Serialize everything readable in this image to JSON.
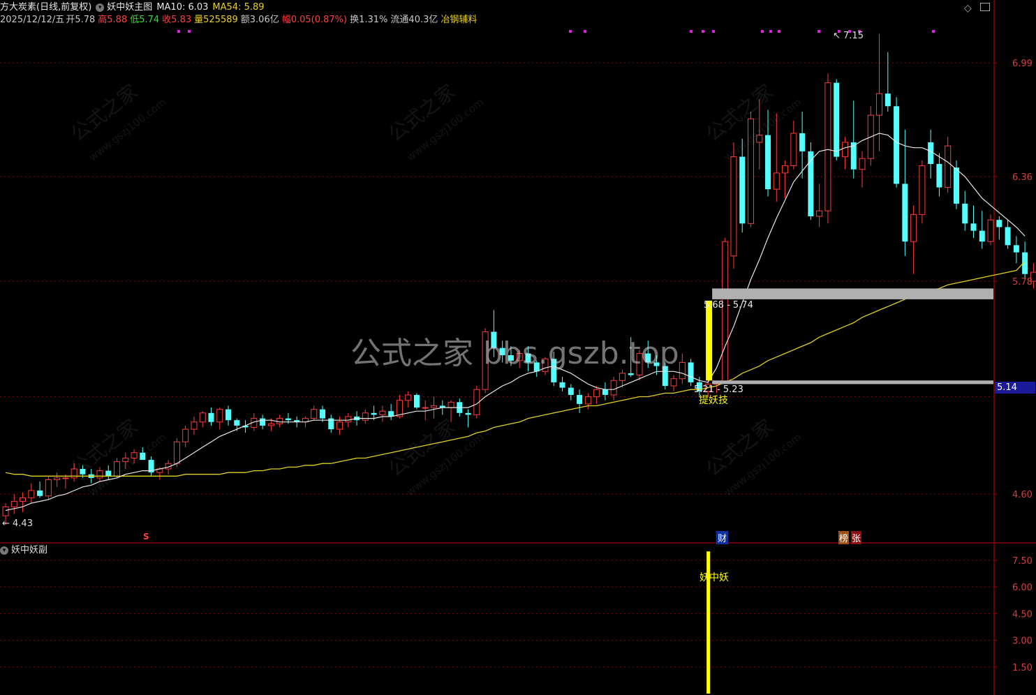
{
  "header": {
    "stock_name": "方大炭素",
    "period": "(日线,前复权)",
    "indicator_name": "妖中妖主图",
    "ma10_label": "MA10: 6.03",
    "ma54_label": "MA54: 5.89",
    "date": "2025/12/12/五",
    "open": "开5.78",
    "high": "高5.88",
    "low": "低5.74",
    "close": "收5.83",
    "volume": "量525589",
    "amount": "额3.06亿",
    "change": "幅0.05(0.87%)",
    "turnover": "换1.31%",
    "float_cap": "流通40.3亿",
    "sector": "冶钢辅料"
  },
  "sub_panel": {
    "title": "妖中妖副",
    "signal_label": "妖中妖"
  },
  "watermark": {
    "center": "公式之家 bbs.gszb.top",
    "tile_cn": "公式之家",
    "tile_url": "www.gszj100.com"
  },
  "colors": {
    "up": "#ff3b3b",
    "down": "#54ffff",
    "ma10": "#e8e8e8",
    "ma54": "#e0d020",
    "grid": "#8b0000",
    "signal": "#ffff00",
    "zone": "#b0b0b0",
    "price_tag_bg": "#1a1a9a"
  },
  "markers": {
    "high_label": "7.15",
    "low_label": "4.43",
    "zone_top_label": "5.68 - 5.74",
    "zone_bottom_label": "5.21 - 5.23",
    "signal_text": "提妖技",
    "current_price_tag": "5.14",
    "event_cai": "财",
    "event_bang": "榜",
    "event_zhang": "张",
    "event_s": "S"
  },
  "chart_data": {
    "type": "candlestick",
    "main_ylim": [
      4.33,
      7.3
    ],
    "main_yticks": [
      "6.99",
      "6.36",
      "5.78",
      "4.60"
    ],
    "sub_yticks": [
      "7.50",
      "6.00",
      "4.50",
      "3.00",
      "1.50"
    ],
    "sub_ylim": [
      0,
      8.4
    ],
    "zone_upper": [
      5.68,
      5.74
    ],
    "zone_lower": [
      5.21,
      5.23
    ],
    "signal_index": 82,
    "candles": [
      {
        "o": 4.48,
        "h": 4.55,
        "l": 4.43,
        "c": 4.53
      },
      {
        "o": 4.53,
        "h": 4.6,
        "l": 4.49,
        "c": 4.56
      },
      {
        "o": 4.56,
        "h": 4.61,
        "l": 4.5,
        "c": 4.58
      },
      {
        "o": 4.58,
        "h": 4.66,
        "l": 4.55,
        "c": 4.62
      },
      {
        "o": 4.62,
        "h": 4.67,
        "l": 4.58,
        "c": 4.59
      },
      {
        "o": 4.59,
        "h": 4.7,
        "l": 4.57,
        "c": 4.68
      },
      {
        "o": 4.68,
        "h": 4.72,
        "l": 4.64,
        "c": 4.69
      },
      {
        "o": 4.69,
        "h": 4.71,
        "l": 4.63,
        "c": 4.69
      },
      {
        "o": 4.69,
        "h": 4.77,
        "l": 4.67,
        "c": 4.74
      },
      {
        "o": 4.74,
        "h": 4.76,
        "l": 4.69,
        "c": 4.71
      },
      {
        "o": 4.71,
        "h": 4.74,
        "l": 4.66,
        "c": 4.69
      },
      {
        "o": 4.69,
        "h": 4.75,
        "l": 4.67,
        "c": 4.73
      },
      {
        "o": 4.73,
        "h": 4.76,
        "l": 4.68,
        "c": 4.7
      },
      {
        "o": 4.7,
        "h": 4.8,
        "l": 4.69,
        "c": 4.78
      },
      {
        "o": 4.78,
        "h": 4.83,
        "l": 4.74,
        "c": 4.8
      },
      {
        "o": 4.8,
        "h": 4.85,
        "l": 4.77,
        "c": 4.83
      },
      {
        "o": 4.83,
        "h": 4.86,
        "l": 4.79,
        "c": 4.79
      },
      {
        "o": 4.79,
        "h": 4.81,
        "l": 4.7,
        "c": 4.72
      },
      {
        "o": 4.72,
        "h": 4.75,
        "l": 4.68,
        "c": 4.74
      },
      {
        "o": 4.74,
        "h": 4.79,
        "l": 4.71,
        "c": 4.77
      },
      {
        "o": 4.77,
        "h": 4.91,
        "l": 4.75,
        "c": 4.89
      },
      {
        "o": 4.89,
        "h": 4.98,
        "l": 4.86,
        "c": 4.96
      },
      {
        "o": 4.96,
        "h": 5.03,
        "l": 4.93,
        "c": 5.0
      },
      {
        "o": 5.0,
        "h": 5.06,
        "l": 4.97,
        "c": 5.05
      },
      {
        "o": 5.05,
        "h": 5.08,
        "l": 4.98,
        "c": 5.0
      },
      {
        "o": 5.0,
        "h": 5.08,
        "l": 4.96,
        "c": 5.07
      },
      {
        "o": 5.07,
        "h": 5.09,
        "l": 4.98,
        "c": 5.01
      },
      {
        "o": 5.01,
        "h": 5.02,
        "l": 4.95,
        "c": 4.98
      },
      {
        "o": 4.98,
        "h": 5.01,
        "l": 4.94,
        "c": 4.97
      },
      {
        "o": 4.97,
        "h": 5.05,
        "l": 4.95,
        "c": 5.02
      },
      {
        "o": 5.02,
        "h": 5.04,
        "l": 4.96,
        "c": 4.98
      },
      {
        "o": 4.98,
        "h": 5.02,
        "l": 4.95,
        "c": 4.99
      },
      {
        "o": 4.99,
        "h": 5.04,
        "l": 4.97,
        "c": 5.02
      },
      {
        "o": 5.02,
        "h": 5.05,
        "l": 4.99,
        "c": 5.01
      },
      {
        "o": 5.01,
        "h": 5.03,
        "l": 4.97,
        "c": 5.0
      },
      {
        "o": 5.0,
        "h": 5.03,
        "l": 4.97,
        "c": 5.02
      },
      {
        "o": 5.02,
        "h": 5.09,
        "l": 5.01,
        "c": 5.07
      },
      {
        "o": 5.07,
        "h": 5.09,
        "l": 5.0,
        "c": 5.02
      },
      {
        "o": 5.02,
        "h": 5.04,
        "l": 4.94,
        "c": 4.96
      },
      {
        "o": 4.96,
        "h": 5.03,
        "l": 4.93,
        "c": 5.0
      },
      {
        "o": 5.0,
        "h": 5.05,
        "l": 4.97,
        "c": 5.03
      },
      {
        "o": 5.03,
        "h": 5.06,
        "l": 4.98,
        "c": 5.01
      },
      {
        "o": 5.01,
        "h": 5.07,
        "l": 4.99,
        "c": 5.05
      },
      {
        "o": 5.05,
        "h": 5.09,
        "l": 5.01,
        "c": 5.04
      },
      {
        "o": 5.04,
        "h": 5.09,
        "l": 5.0,
        "c": 5.06
      },
      {
        "o": 5.06,
        "h": 5.1,
        "l": 5.01,
        "c": 5.03
      },
      {
        "o": 5.03,
        "h": 5.15,
        "l": 5.02,
        "c": 5.12
      },
      {
        "o": 5.12,
        "h": 5.17,
        "l": 5.08,
        "c": 5.15
      },
      {
        "o": 5.15,
        "h": 5.16,
        "l": 5.07,
        "c": 5.08
      },
      {
        "o": 5.08,
        "h": 5.12,
        "l": 5.01,
        "c": 5.08
      },
      {
        "o": 5.08,
        "h": 5.14,
        "l": 5.02,
        "c": 5.09
      },
      {
        "o": 5.09,
        "h": 5.12,
        "l": 5.04,
        "c": 5.08
      },
      {
        "o": 5.08,
        "h": 5.12,
        "l": 5.0,
        "c": 5.11
      },
      {
        "o": 5.11,
        "h": 5.13,
        "l": 5.03,
        "c": 5.05
      },
      {
        "o": 5.05,
        "h": 5.07,
        "l": 4.97,
        "c": 5.04
      },
      {
        "o": 5.04,
        "h": 5.2,
        "l": 5.02,
        "c": 5.18
      },
      {
        "o": 5.18,
        "h": 5.52,
        "l": 5.16,
        "c": 5.5
      },
      {
        "o": 5.5,
        "h": 5.62,
        "l": 5.36,
        "c": 5.41
      },
      {
        "o": 5.41,
        "h": 5.45,
        "l": 5.33,
        "c": 5.37
      },
      {
        "o": 5.37,
        "h": 5.42,
        "l": 5.31,
        "c": 5.34
      },
      {
        "o": 5.34,
        "h": 5.4,
        "l": 5.3,
        "c": 5.38
      },
      {
        "o": 5.38,
        "h": 5.42,
        "l": 5.28,
        "c": 5.33
      },
      {
        "o": 5.33,
        "h": 5.34,
        "l": 5.25,
        "c": 5.28
      },
      {
        "o": 5.28,
        "h": 5.36,
        "l": 5.26,
        "c": 5.35
      },
      {
        "o": 5.35,
        "h": 5.39,
        "l": 5.2,
        "c": 5.22
      },
      {
        "o": 5.22,
        "h": 5.25,
        "l": 5.17,
        "c": 5.19
      },
      {
        "o": 5.19,
        "h": 5.21,
        "l": 5.12,
        "c": 5.15
      },
      {
        "o": 5.15,
        "h": 5.18,
        "l": 5.05,
        "c": 5.1
      },
      {
        "o": 5.1,
        "h": 5.16,
        "l": 5.07,
        "c": 5.14
      },
      {
        "o": 5.14,
        "h": 5.2,
        "l": 5.1,
        "c": 5.18
      },
      {
        "o": 5.18,
        "h": 5.22,
        "l": 5.12,
        "c": 5.15
      },
      {
        "o": 5.15,
        "h": 5.25,
        "l": 5.12,
        "c": 5.23
      },
      {
        "o": 5.23,
        "h": 5.29,
        "l": 5.19,
        "c": 5.27
      },
      {
        "o": 5.27,
        "h": 5.47,
        "l": 5.25,
        "c": 5.26
      },
      {
        "o": 5.26,
        "h": 5.4,
        "l": 5.23,
        "c": 5.38
      },
      {
        "o": 5.38,
        "h": 5.45,
        "l": 5.3,
        "c": 5.33
      },
      {
        "o": 5.33,
        "h": 5.37,
        "l": 5.26,
        "c": 5.31
      },
      {
        "o": 5.31,
        "h": 5.33,
        "l": 5.18,
        "c": 5.2
      },
      {
        "o": 5.2,
        "h": 5.26,
        "l": 5.17,
        "c": 5.24
      },
      {
        "o": 5.24,
        "h": 5.38,
        "l": 5.21,
        "c": 5.33
      },
      {
        "o": 5.33,
        "h": 5.35,
        "l": 5.2,
        "c": 5.22
      },
      {
        "o": 5.22,
        "h": 5.25,
        "l": 5.14,
        "c": 5.17
      },
      {
        "o": 5.17,
        "h": 5.26,
        "l": 5.14,
        "c": 5.21
      },
      {
        "o": 5.21,
        "h": 5.23,
        "l": 5.16,
        "c": 5.22
      },
      {
        "o": 5.22,
        "h": 6.02,
        "l": 5.82,
        "c": 6.0
      },
      {
        "o": 5.92,
        "h": 6.55,
        "l": 5.85,
        "c": 6.47
      },
      {
        "o": 6.47,
        "h": 6.57,
        "l": 6.05,
        "c": 6.1
      },
      {
        "o": 6.1,
        "h": 6.72,
        "l": 6.08,
        "c": 6.68
      },
      {
        "o": 6.55,
        "h": 6.79,
        "l": 6.4,
        "c": 6.59
      },
      {
        "o": 6.59,
        "h": 6.73,
        "l": 6.25,
        "c": 6.29
      },
      {
        "o": 6.29,
        "h": 6.71,
        "l": 6.22,
        "c": 6.38
      },
      {
        "o": 6.38,
        "h": 6.45,
        "l": 6.24,
        "c": 6.42
      },
      {
        "o": 6.42,
        "h": 6.67,
        "l": 6.4,
        "c": 6.6
      },
      {
        "o": 6.6,
        "h": 6.72,
        "l": 6.35,
        "c": 6.5
      },
      {
        "o": 6.5,
        "h": 6.55,
        "l": 6.12,
        "c": 6.14
      },
      {
        "o": 6.14,
        "h": 6.32,
        "l": 6.08,
        "c": 6.17
      },
      {
        "o": 6.17,
        "h": 6.93,
        "l": 6.1,
        "c": 6.88
      },
      {
        "o": 6.88,
        "h": 6.9,
        "l": 6.45,
        "c": 6.47
      },
      {
        "o": 6.47,
        "h": 6.58,
        "l": 6.4,
        "c": 6.55
      },
      {
        "o": 6.55,
        "h": 6.78,
        "l": 6.35,
        "c": 6.4
      },
      {
        "o": 6.4,
        "h": 6.5,
        "l": 6.3,
        "c": 6.46
      },
      {
        "o": 6.46,
        "h": 6.75,
        "l": 6.42,
        "c": 6.7
      },
      {
        "o": 6.7,
        "h": 7.15,
        "l": 6.5,
        "c": 6.82
      },
      {
        "o": 6.82,
        "h": 7.05,
        "l": 6.72,
        "c": 6.75
      },
      {
        "o": 6.75,
        "h": 6.8,
        "l": 6.3,
        "c": 6.32
      },
      {
        "o": 6.32,
        "h": 6.62,
        "l": 5.92,
        "c": 6.0
      },
      {
        "o": 6.0,
        "h": 6.2,
        "l": 5.82,
        "c": 6.15
      },
      {
        "o": 6.15,
        "h": 6.45,
        "l": 6.1,
        "c": 6.42
      },
      {
        "o": 6.55,
        "h": 6.62,
        "l": 6.35,
        "c": 6.43
      },
      {
        "o": 6.43,
        "h": 6.49,
        "l": 6.25,
        "c": 6.3
      },
      {
        "o": 6.3,
        "h": 6.58,
        "l": 6.27,
        "c": 6.53
      },
      {
        "o": 6.41,
        "h": 6.45,
        "l": 6.18,
        "c": 6.21
      },
      {
        "o": 6.21,
        "h": 6.28,
        "l": 6.06,
        "c": 6.1
      },
      {
        "o": 6.1,
        "h": 6.2,
        "l": 6.02,
        "c": 6.06
      },
      {
        "o": 6.06,
        "h": 6.17,
        "l": 5.96,
        "c": 6.0
      },
      {
        "o": 6.0,
        "h": 6.15,
        "l": 5.98,
        "c": 6.12
      },
      {
        "o": 6.12,
        "h": 6.14,
        "l": 6.01,
        "c": 6.08
      },
      {
        "o": 6.08,
        "h": 6.12,
        "l": 5.96,
        "c": 5.98
      },
      {
        "o": 5.98,
        "h": 6.03,
        "l": 5.88,
        "c": 5.94
      },
      {
        "o": 5.94,
        "h": 6.0,
        "l": 5.79,
        "c": 5.82
      },
      {
        "o": 5.78,
        "h": 5.88,
        "l": 5.74,
        "c": 5.83
      }
    ],
    "ma10": [
      4.51,
      4.52,
      4.53,
      4.55,
      4.56,
      4.57,
      4.59,
      4.6,
      4.62,
      4.64,
      4.65,
      4.67,
      4.68,
      4.69,
      4.71,
      4.72,
      4.73,
      4.73,
      4.74,
      4.75,
      4.77,
      4.8,
      4.83,
      4.86,
      4.89,
      4.92,
      4.94,
      4.96,
      4.98,
      5.0,
      5.01,
      5.01,
      5.0,
      5.0,
      5.0,
      5.0,
      5.01,
      5.01,
      5.01,
      5.01,
      5.01,
      5.02,
      5.02,
      5.02,
      5.03,
      5.03,
      5.04,
      5.05,
      5.06,
      5.06,
      5.07,
      5.08,
      5.08,
      5.08,
      5.08,
      5.1,
      5.14,
      5.17,
      5.2,
      5.22,
      5.25,
      5.27,
      5.28,
      5.3,
      5.31,
      5.29,
      5.27,
      5.24,
      5.21,
      5.19,
      5.18,
      5.18,
      5.2,
      5.22,
      5.24,
      5.26,
      5.28,
      5.28,
      5.28,
      5.27,
      5.25,
      5.23,
      5.22,
      5.3,
      5.42,
      5.53,
      5.66,
      5.79,
      5.9,
      6.02,
      6.13,
      6.23,
      6.33,
      6.39,
      6.45,
      6.5,
      6.51,
      6.5,
      6.52,
      6.53,
      6.56,
      6.58,
      6.6,
      6.59,
      6.55,
      6.53,
      6.52,
      6.52,
      6.5,
      6.47,
      6.44,
      6.4,
      6.36,
      6.3,
      6.24,
      6.2,
      6.16,
      6.12,
      6.08,
      6.03
    ],
    "ma54": [
      4.72,
      4.71,
      4.71,
      4.7,
      4.7,
      4.7,
      4.7,
      4.7,
      4.7,
      4.7,
      4.7,
      4.7,
      4.7,
      4.7,
      4.7,
      4.7,
      4.7,
      4.7,
      4.7,
      4.7,
      4.7,
      4.71,
      4.71,
      4.71,
      4.71,
      4.71,
      4.72,
      4.72,
      4.72,
      4.73,
      4.73,
      4.74,
      4.74,
      4.75,
      4.75,
      4.76,
      4.76,
      4.77,
      4.77,
      4.78,
      4.79,
      4.8,
      4.8,
      4.81,
      4.82,
      4.83,
      4.84,
      4.85,
      4.86,
      4.87,
      4.88,
      4.89,
      4.9,
      4.91,
      4.92,
      4.94,
      4.95,
      4.97,
      4.98,
      4.99,
      5.0,
      5.02,
      5.03,
      5.04,
      5.05,
      5.06,
      5.07,
      5.08,
      5.09,
      5.09,
      5.1,
      5.11,
      5.12,
      5.13,
      5.14,
      5.14,
      5.15,
      5.16,
      5.16,
      5.17,
      5.18,
      5.18,
      5.19,
      5.2,
      5.22,
      5.24,
      5.27,
      5.29,
      5.31,
      5.34,
      5.36,
      5.38,
      5.4,
      5.42,
      5.44,
      5.47,
      5.49,
      5.51,
      5.53,
      5.55,
      5.58,
      5.6,
      5.62,
      5.64,
      5.66,
      5.68,
      5.7,
      5.71,
      5.73,
      5.74,
      5.76,
      5.77,
      5.78,
      5.79,
      5.8,
      5.81,
      5.82,
      5.83,
      5.84,
      5.89
    ]
  }
}
